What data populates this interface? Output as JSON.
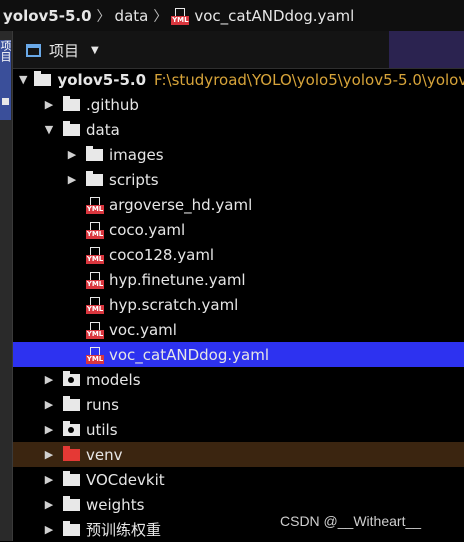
{
  "breadcrumb": {
    "items": [
      "yolov5-5.0",
      "data",
      "voc_catANDdog.yaml"
    ],
    "separator": "〉"
  },
  "toolstrip": {
    "tab_label": "项目"
  },
  "panel": {
    "title": "项目",
    "caret": "▼"
  },
  "tree": {
    "root": {
      "name": "yolov5-5.0",
      "path": "F:\\studyroad\\YOLO\\yolo5\\yolov5-5.0\\yolov"
    },
    "github": ".github",
    "data": "data",
    "images": "images",
    "scripts": "scripts",
    "files": [
      "argoverse_hd.yaml",
      "coco.yaml",
      "coco128.yaml",
      "hyp.finetune.yaml",
      "hyp.scratch.yaml",
      "voc.yaml",
      "voc_catANDdog.yaml"
    ],
    "models": "models",
    "runs": "runs",
    "utils": "utils",
    "venv": "venv",
    "vocdevkit": "VOCdevkit",
    "weights": "weights",
    "pretrained": "预训练权重"
  },
  "glyphs": {
    "expanded": "▼",
    "collapsed": "▶",
    "yml_tag": "YML"
  },
  "watermark": "CSDN @__Witheart__",
  "colors": {
    "selection": "#2d32f0",
    "excluded_row": "#3b2510",
    "path_text": "#d7a43a",
    "excluded_folder": "#e53935",
    "yml_badge": "#d9363e"
  }
}
